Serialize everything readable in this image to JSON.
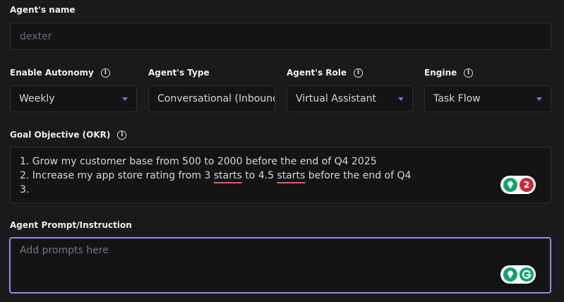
{
  "agent_name": {
    "label": "Agent's name",
    "placeholder": "dexter"
  },
  "fields": {
    "autonomy": {
      "label": "Enable Autonomy",
      "value": "Weekly"
    },
    "type": {
      "label": "Agent's Type",
      "value": "Conversational (Inbound)"
    },
    "role": {
      "label": "Agent's Role",
      "value": "Virtual Assistant"
    },
    "engine": {
      "label": "Engine",
      "value": "Task Flow"
    }
  },
  "goal": {
    "label": "Goal Objective (OKR)",
    "line1": "1. Grow my customer base from 500 to 2000 before the end of Q4 2025",
    "line2_a": "2. Increase my app store rating from 3 ",
    "line2_b": "starts",
    "line2_c": " to 4.5 ",
    "line2_d": "starts",
    "line2_e": " before the end of Q4",
    "line3": "3.",
    "grammarly_count": "2"
  },
  "prompt": {
    "label": "Agent Prompt/Instruction",
    "placeholder": "Add prompts here"
  },
  "icons": {
    "info": "info-icon",
    "caret": "caret-down-icon",
    "bulb": "lightbulb-icon",
    "grammarly": "grammarly-icon"
  },
  "colors": {
    "accent": "#7c6cf0",
    "focus_border": "#9a86e8",
    "spell_underline": "#e05a6e",
    "grammarly_green": "#15a36d",
    "grammarly_red": "#c8283c"
  }
}
